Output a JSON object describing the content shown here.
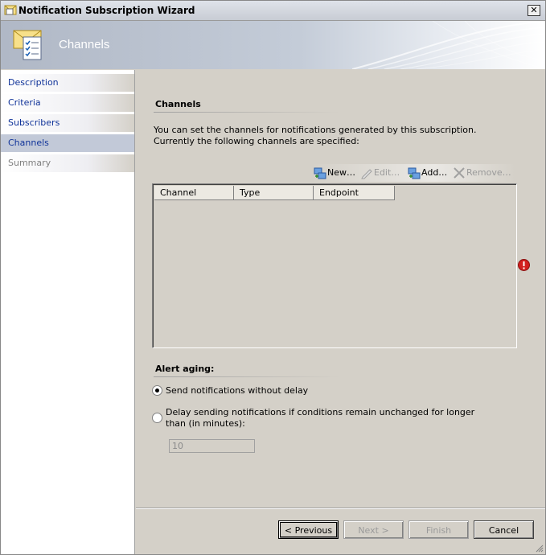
{
  "window": {
    "title": "Notification Subscription Wizard",
    "close_glyph": "✕"
  },
  "header": {
    "title": "Channels",
    "icon": "envelope-checklist-icon"
  },
  "sidebar": {
    "items": [
      {
        "label": "Description",
        "state": "normal"
      },
      {
        "label": "Criteria",
        "state": "normal"
      },
      {
        "label": "Subscribers",
        "state": "normal"
      },
      {
        "label": "Channels",
        "state": "selected"
      },
      {
        "label": "Summary",
        "state": "disabled"
      }
    ]
  },
  "main": {
    "section_title": "Channels",
    "description": "You can set the channels for notifications generated by this subscription.  Currently the following channels are specified:",
    "toolbar": {
      "new_label": "New…",
      "edit_label": "Edit…",
      "add_label": "Add…",
      "remove_label": "Remove…"
    },
    "grid": {
      "columns": [
        "Channel",
        "Type",
        "Endpoint"
      ],
      "rows": []
    },
    "alert_aging": {
      "title": "Alert aging:",
      "option_immediate": "Send notifications without delay",
      "option_delay": "Delay sending notifications if conditions remain unchanged for longer than (in minutes):",
      "selected": "immediate",
      "delay_minutes": "10"
    }
  },
  "footer": {
    "previous_label": "< Previous",
    "next_label": "Next >",
    "finish_label": "Finish",
    "cancel_label": "Cancel"
  },
  "colors": {
    "nav_link": "#103399",
    "selected_nav": "#c2c9d8",
    "error": "#d21f1f"
  }
}
